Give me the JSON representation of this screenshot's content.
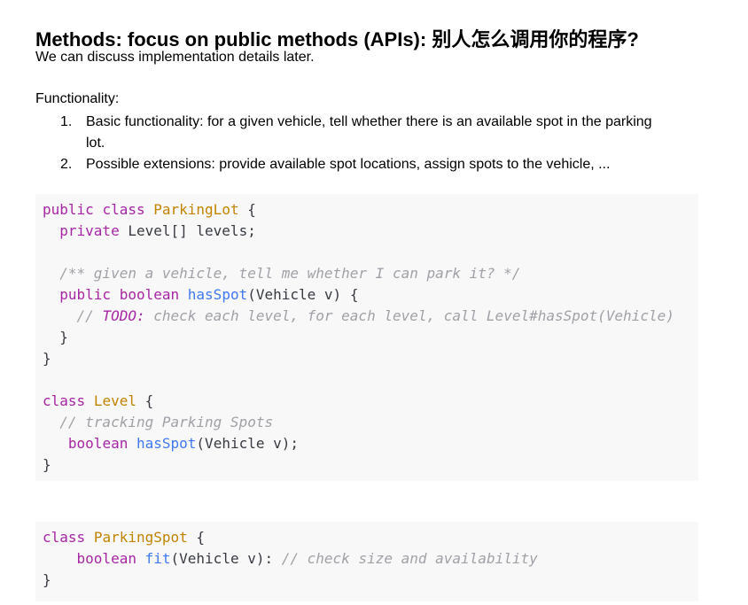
{
  "heading": "Methods: focus on public methods (APIs): 别人怎么调用你的程序?",
  "subtitle": "We can discuss implementation details later.",
  "functionality": {
    "label": "Functionality:",
    "items": [
      {
        "num": "1.",
        "text": "Basic functionality: for a given vehicle, tell whether there is an available spot in the parking lot."
      },
      {
        "num": "2.",
        "text": "Possible extensions: provide available spot locations, assign spots to the vehicle, ..."
      }
    ]
  },
  "code_blocks": [
    {
      "lines": [
        [
          {
            "t": "public",
            "c": "kw"
          },
          {
            "t": " "
          },
          {
            "t": "class",
            "c": "kw"
          },
          {
            "t": " "
          },
          {
            "t": "ParkingLot",
            "c": "cls"
          },
          {
            "t": " {"
          }
        ],
        [
          {
            "t": "  "
          },
          {
            "t": "private",
            "c": "kw"
          },
          {
            "t": " Level[] levels;"
          }
        ],
        [],
        [
          {
            "t": "  "
          },
          {
            "t": "/** given a vehicle, tell me whether I can park it? */",
            "c": "cm"
          }
        ],
        [
          {
            "t": "  "
          },
          {
            "t": "public",
            "c": "kw"
          },
          {
            "t": " "
          },
          {
            "t": "boolean",
            "c": "kw"
          },
          {
            "t": " "
          },
          {
            "t": "hasSpot",
            "c": "fn"
          },
          {
            "t": "(Vehicle v) {"
          }
        ],
        [
          {
            "t": "    "
          },
          {
            "t": "// ",
            "c": "cm"
          },
          {
            "t": "TODO:",
            "c": "todo"
          },
          {
            "t": " check each level, for each level, call Level#hasSpot(Vehicle)",
            "c": "cm"
          }
        ],
        [
          {
            "t": "  }"
          }
        ],
        [
          {
            "t": "}"
          }
        ],
        [],
        [
          {
            "t": "class",
            "c": "kw"
          },
          {
            "t": " "
          },
          {
            "t": "Level",
            "c": "cls"
          },
          {
            "t": " {"
          }
        ],
        [
          {
            "t": "  "
          },
          {
            "t": "// tracking Parking Spots",
            "c": "cm"
          }
        ],
        [
          {
            "t": "   "
          },
          {
            "t": "boolean",
            "c": "kw"
          },
          {
            "t": " "
          },
          {
            "t": "hasSpot",
            "c": "fn"
          },
          {
            "t": "(Vehicle v);"
          }
        ],
        [
          {
            "t": "}"
          }
        ]
      ]
    },
    {
      "lines": [
        [
          {
            "t": "class",
            "c": "kw"
          },
          {
            "t": " "
          },
          {
            "t": "ParkingSpot",
            "c": "cls"
          },
          {
            "t": " {"
          }
        ],
        [
          {
            "t": "    "
          },
          {
            "t": "boolean",
            "c": "kw"
          },
          {
            "t": " "
          },
          {
            "t": "fit",
            "c": "fn"
          },
          {
            "t": "(Vehicle v): "
          },
          {
            "t": "// check size and availability",
            "c": "cm"
          }
        ],
        [
          {
            "t": "}"
          }
        ]
      ]
    }
  ]
}
